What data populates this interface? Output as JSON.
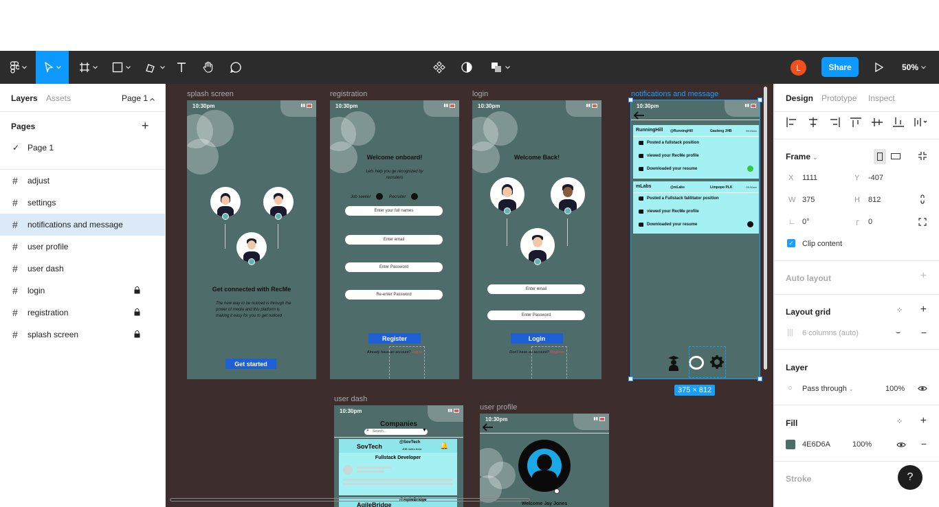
{
  "toolbar": {
    "share_label": "Share",
    "zoom_label": "50%",
    "avatar_initial": "L"
  },
  "left_panel": {
    "tabs": [
      "Layers",
      "Assets"
    ],
    "page_selector": "Page 1",
    "pages_heading": "Pages",
    "pages": [
      "Page 1"
    ],
    "layers": [
      {
        "name": "adjust",
        "locked": false,
        "selected": false
      },
      {
        "name": "settings",
        "locked": false,
        "selected": false
      },
      {
        "name": "notifications and message",
        "locked": false,
        "selected": true
      },
      {
        "name": "user profile",
        "locked": false,
        "selected": false
      },
      {
        "name": "user dash",
        "locked": false,
        "selected": false
      },
      {
        "name": "login",
        "locked": true,
        "selected": false
      },
      {
        "name": "registration",
        "locked": true,
        "selected": false
      },
      {
        "name": "splash screen",
        "locked": true,
        "selected": false
      }
    ]
  },
  "canvas": {
    "frames": {
      "splash": {
        "label": "splash screen",
        "time": "10:30pm",
        "title": "Get connected with RecMe",
        "body": "The new way to be noticed is through the power of media and this platform is making it easy for you to get noticed",
        "cta": "Get started"
      },
      "registration": {
        "label": "registration",
        "time": "10:30pm",
        "title": "Welcome onboard!",
        "subtitle": "Lets help you ge recognized by recruiters",
        "opt_job_seeker": "Job  seeker",
        "opt_recruiter": "Recruiter",
        "inputs": [
          "Enter your full names",
          "Enter email",
          "Enter Password",
          "Re-enter Password"
        ],
        "cta": "Register",
        "note": "Already have an account?",
        "note_link": "Log in"
      },
      "login": {
        "label": "login",
        "time": "10:30pm",
        "title": "Welcome Back!",
        "inputs": [
          "Enter email",
          "Enter Password"
        ],
        "cta": "Login",
        "note": "Don't have an account?",
        "note_link": "Register"
      },
      "notifications": {
        "label": "notifications and message",
        "time": "10:30pm",
        "cards": [
          {
            "company": "RunningHill",
            "handle": "@RunningHill",
            "location": "Gauteng JHB",
            "time": "09:05am",
            "items": [
              "Posted a fullstack position",
              "viewed your RecMe profile",
              "Downloaded your resume"
            ]
          },
          {
            "company": "mLabs",
            "handle": "@mLabs",
            "location": "Limpopo PLK",
            "time": "05:00am",
            "items": [
              "Posted a Fullstack falilitator  position",
              "viewed your RecMe profile",
              "Downloaded your resume"
            ]
          }
        ],
        "size_tag": "375 × 812"
      },
      "user_dash": {
        "label": "user dash",
        "time": "10:30pm",
        "title": "Companies",
        "search_placeholder": "Search...",
        "company": "SovTech",
        "handle": "@SovTech",
        "location": "JHB metro Area",
        "job": "Fullstack Developer",
        "company2": "AgileBridge",
        "handle2": "@AgileBridge"
      },
      "user_profile": {
        "label": "user profile",
        "time": "10:30pm",
        "greeting": "Welcome Jay Jones"
      }
    }
  },
  "right_panel": {
    "tabs": [
      "Design",
      "Prototype",
      "Inspect"
    ],
    "frame_label": "Frame",
    "x_label": "X",
    "x": "1111",
    "y_label": "Y",
    "y": "-407",
    "w_label": "W",
    "w": "375",
    "h_label": "H",
    "h": "812",
    "rotation": "0°",
    "radius": "0",
    "clip_content": "Clip content",
    "auto_layout": "Auto layout",
    "layout_grid": "Layout grid",
    "grid_value": "6 columns (auto)",
    "layer": "Layer",
    "blend": "Pass through",
    "layer_opacity": "100%",
    "fill": "Fill",
    "fill_hex": "4E6D6A",
    "fill_opacity": "100%",
    "stroke": "Stroke",
    "fill_color": "#4e6d6a"
  },
  "help_label": "?"
}
